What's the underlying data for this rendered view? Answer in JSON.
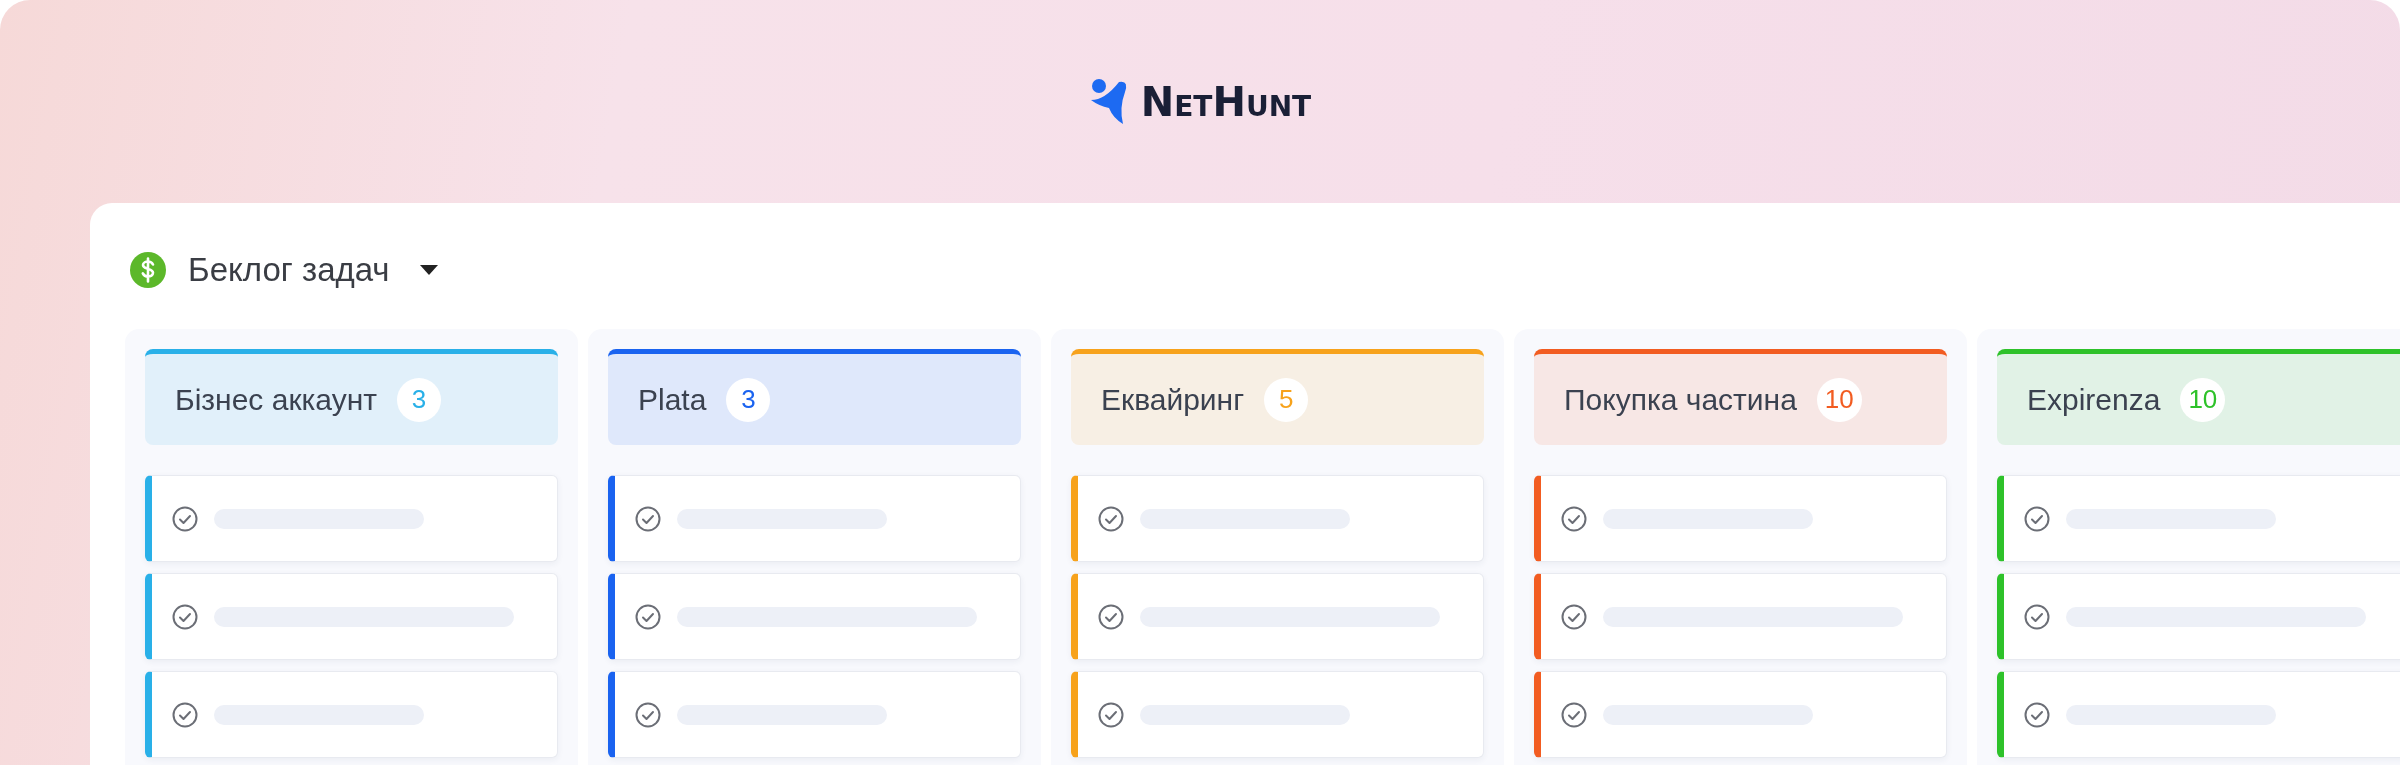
{
  "logo": {
    "name": "NetHunt"
  },
  "board": {
    "title": "Беклог задач",
    "columns": [
      {
        "name": "Бізнес аккаунт",
        "count": "3",
        "color": "#29b0e8",
        "cards": [
          {
            "kind": "placeholder"
          },
          {
            "kind": "placeholder"
          },
          {
            "kind": "placeholder"
          }
        ]
      },
      {
        "name": "Plata",
        "count": "3",
        "color": "#1a63f0",
        "cards": [
          {
            "kind": "placeholder"
          },
          {
            "kind": "placeholder"
          },
          {
            "kind": "placeholder"
          }
        ]
      },
      {
        "name": "Еквайринг",
        "count": "5",
        "color": "#f7a21b",
        "cards": [
          {
            "kind": "placeholder"
          },
          {
            "kind": "placeholder"
          },
          {
            "kind": "placeholder"
          }
        ]
      },
      {
        "name": "Покупка частина",
        "count": "10",
        "color": "#f25c21",
        "cards": [
          {
            "kind": "placeholder"
          },
          {
            "kind": "placeholder"
          },
          {
            "kind": "placeholder"
          }
        ]
      },
      {
        "name": "Expirenza",
        "count": "10",
        "color": "#2ec22a",
        "cards": [
          {
            "kind": "placeholder"
          },
          {
            "kind": "placeholder"
          },
          {
            "kind": "placeholder"
          }
        ]
      }
    ]
  }
}
